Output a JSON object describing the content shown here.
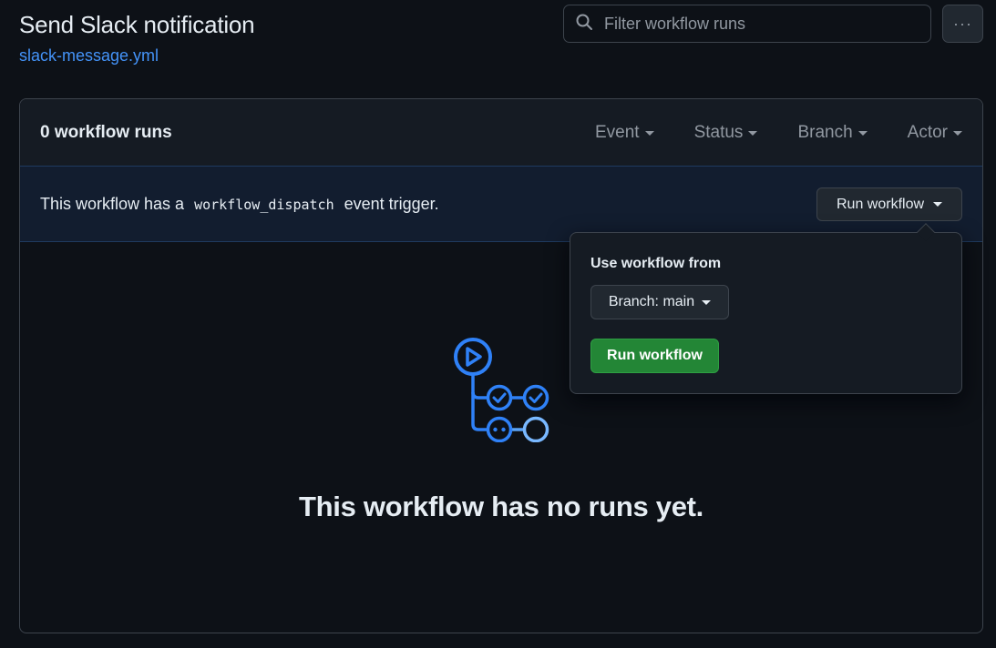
{
  "header": {
    "title": "Send Slack notification",
    "file_link": "slack-message.yml"
  },
  "search": {
    "placeholder": "Filter workflow runs"
  },
  "more_button_label": "···",
  "runs": {
    "count_label": "0 workflow runs",
    "filters": [
      "Event",
      "Status",
      "Branch",
      "Actor"
    ]
  },
  "dispatch": {
    "text_before": "This workflow has a",
    "code": "workflow_dispatch",
    "text_after": "event trigger.",
    "run_button_label": "Run workflow"
  },
  "dropdown": {
    "label": "Use workflow from",
    "branch_button_label": "Branch: main",
    "run_button_label": "Run workflow"
  },
  "empty": {
    "message": "This workflow has no runs yet."
  },
  "colors": {
    "background": "#0d1117",
    "accent_blue": "#4493f8",
    "green": "#238636",
    "dispatch_bg": "#121d2f"
  }
}
